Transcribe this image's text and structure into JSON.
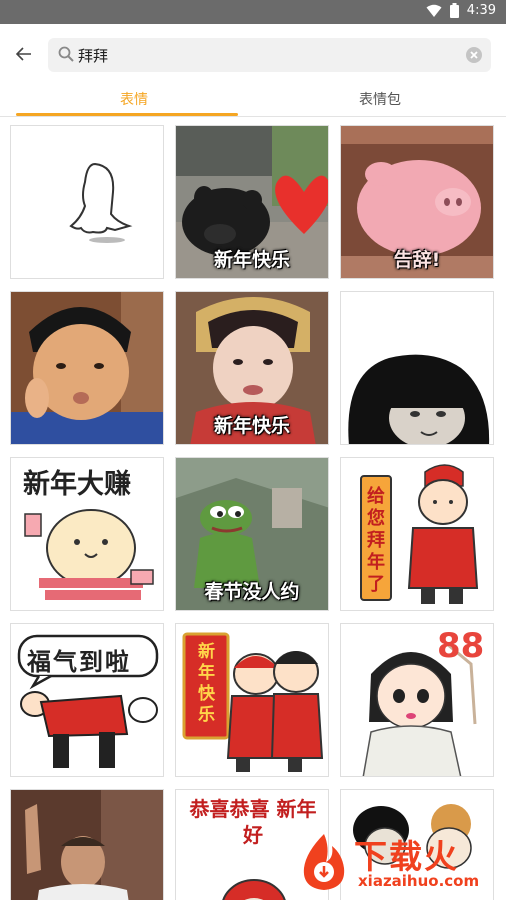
{
  "status_bar": {
    "time": "4:39"
  },
  "search": {
    "query": "拜拜"
  },
  "tabs": [
    {
      "label": "表情",
      "active": true
    },
    {
      "label": "表情包",
      "active": false
    }
  ],
  "stickers": [
    {
      "caption": ""
    },
    {
      "caption": "新年快乐"
    },
    {
      "caption": "告辞!"
    },
    {
      "caption": ""
    },
    {
      "caption": "新年快乐"
    },
    {
      "caption": ""
    },
    {
      "caption": "新年大赚"
    },
    {
      "caption": "春节没人约"
    },
    {
      "caption": "给您拜年了"
    },
    {
      "caption": "福气到啦"
    },
    {
      "caption": "新年快乐"
    },
    {
      "caption": "88"
    },
    {
      "caption": ""
    },
    {
      "caption": "恭喜恭喜 新年好"
    },
    {
      "caption": ""
    }
  ],
  "watermark": {
    "brand": "下载火",
    "url": "xiazaihuo.com"
  },
  "colors": {
    "accent": "#f5a623",
    "status_bar": "#6b6b6b",
    "watermark": "#f0411e"
  }
}
